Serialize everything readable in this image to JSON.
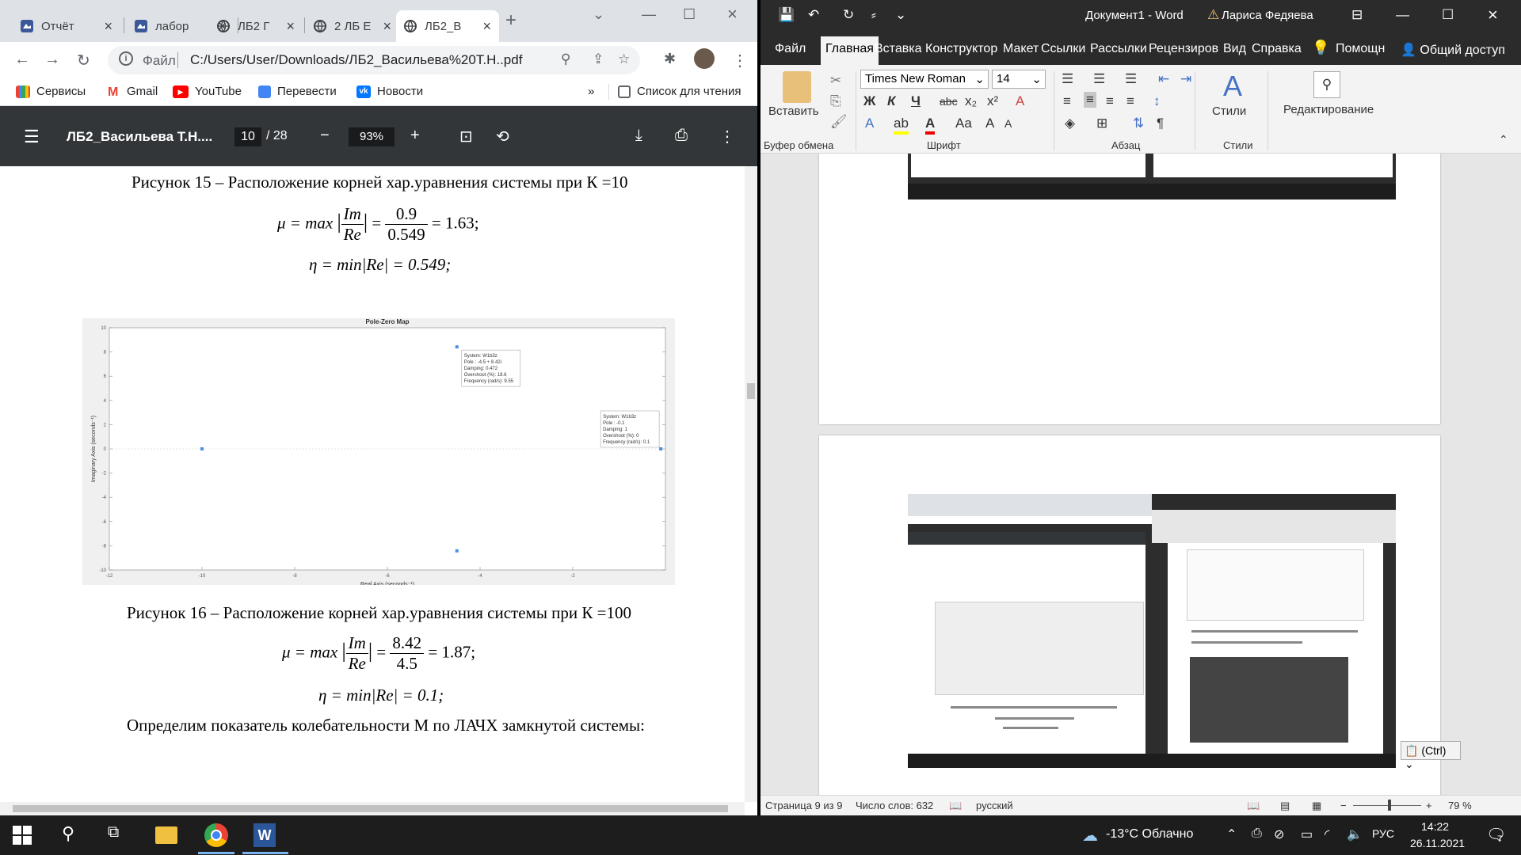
{
  "chrome": {
    "tabs": [
      {
        "label": "Отчёт",
        "icon": "cloud-icon"
      },
      {
        "label": "лабор",
        "icon": "cloud-icon"
      },
      {
        "label": "ЛБ2 Г",
        "icon": "globe-icon"
      },
      {
        "label": "2 ЛБ Е",
        "icon": "globe-icon"
      },
      {
        "label": "ЛБ2_В",
        "icon": "globe-icon"
      }
    ],
    "scheme": "Файл",
    "url": "C:/Users/User/Downloads/ЛБ2_Васильева%20Т.Н..pdf",
    "bookmarks": [
      "Сервисы",
      "Gmail",
      "YouTube",
      "Перевести",
      "Новости"
    ],
    "reading_list": "Список для чтения",
    "pdf": {
      "title": "ЛБ2_Васильева Т.Н....",
      "page": "10",
      "page_total": "/ 28",
      "zoom": "93%"
    },
    "content": {
      "caption15": "Рисунок 15 – Расположение корней хар.уравнения системы при К =10",
      "eq1_left": "μ = max",
      "eq1_im": "Im",
      "eq1_re": "Re",
      "eq1_num": "0.9",
      "eq1_den": "0.549",
      "eq1_res": "= 1.63;",
      "eq2": "η = min|Re| = 0.549;",
      "caption16": "Рисунок 16 – Расположение корней хар.уравнения системы при К =100",
      "eq3_left": "μ = max",
      "eq3_num": "8.42",
      "eq3_den": "4.5",
      "eq3_res": "= 1.87;",
      "eq4": "η = min|Re| = 0.1;",
      "para": "Определим показатель колебательности М по ЛАЧХ замкнутой системы:"
    }
  },
  "chart_data": {
    "type": "scatter",
    "title": "Pole-Zero Map",
    "xlabel": "Real Axis (seconds⁻¹)",
    "ylabel": "Imaginary Axis (seconds⁻¹)",
    "xlim": [
      -12,
      0
    ],
    "ylim": [
      -10,
      10
    ],
    "xticks": [
      -12,
      -10,
      -8,
      -6,
      -4,
      -2
    ],
    "yticks": [
      10,
      8,
      6,
      4,
      2,
      0,
      -2,
      -4,
      -6,
      -8,
      -10
    ],
    "points": [
      {
        "x": -10,
        "y": 0
      },
      {
        "x": -4.5,
        "y": 8.42
      },
      {
        "x": -4.5,
        "y": -8.42
      },
      {
        "x": -0.1,
        "y": 0
      }
    ],
    "datatips": [
      {
        "x": -4.5,
        "y": 8.42,
        "lines": [
          "System: W1b3z",
          "Pole : -4.5 + 8.42i",
          "Damping: 0.472",
          "Overshoot (%): 18.6",
          "Frequency (rad/s): 9.55"
        ]
      },
      {
        "x": -0.1,
        "y": 0,
        "lines": [
          "System: W1b3z",
          "Pole : -0.1",
          "Damping: 1",
          "Overshoot (%): 0",
          "Frequency (rad/s): 0.1"
        ]
      }
    ]
  },
  "word": {
    "title": "Документ1 - Word",
    "user": "Лариса Федяева",
    "menu": [
      "Файл",
      "Главная",
      "Вставка",
      "Конструктор",
      "Макет",
      "Ссылки",
      "Рассылки",
      "Рецензиров",
      "Вид",
      "Справка",
      "Помощн",
      "Общий доступ"
    ],
    "font": "Times New Roman",
    "size": "14",
    "paste": "Вставить",
    "styles": "Стили",
    "editing": "Редактирование",
    "groups": [
      "Буфер обмена",
      "Шрифт",
      "Абзац",
      "Стили"
    ],
    "ctrl": "(Ctrl)",
    "status": {
      "page": "Страница 9 из 9",
      "words": "Число слов: 632",
      "lang": "русский",
      "zoom": "79 %"
    }
  },
  "taskbar": {
    "weather": "-13°C  Облачно",
    "lang": "РУС",
    "time": "14:22",
    "date": "26.11.2021",
    "notifications": "7"
  }
}
